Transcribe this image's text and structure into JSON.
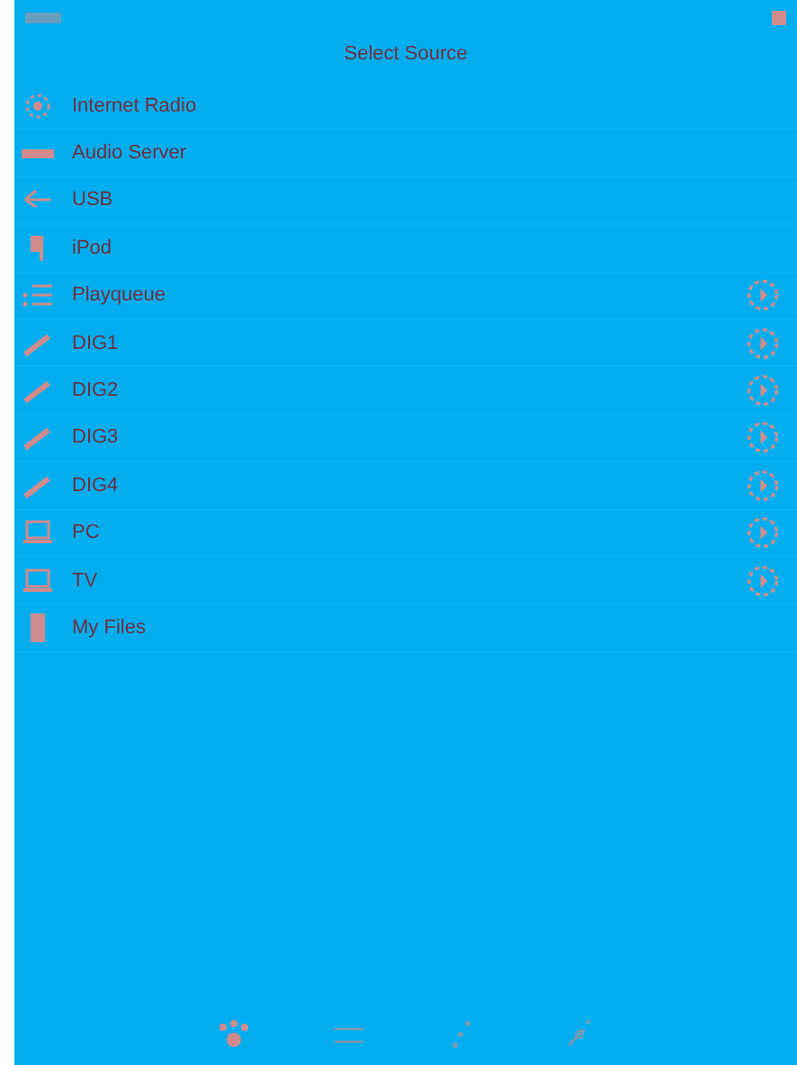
{
  "title": "Select Source",
  "sources": [
    {
      "label": "Internet Radio",
      "kind": "radio",
      "info": false
    },
    {
      "label": "Audio Server",
      "kind": "server",
      "info": false
    },
    {
      "label": "USB",
      "kind": "usb",
      "info": false
    },
    {
      "label": "iPod",
      "kind": "ipod",
      "info": false
    },
    {
      "label": "Playqueue",
      "kind": "queue",
      "info": true
    },
    {
      "label": "DIG1",
      "kind": "plug",
      "info": true
    },
    {
      "label": "DIG2",
      "kind": "plug",
      "info": true
    },
    {
      "label": "DIG3",
      "kind": "plug",
      "info": true
    },
    {
      "label": "DIG4",
      "kind": "plug",
      "info": true
    },
    {
      "label": "PC",
      "kind": "laptop",
      "info": true
    },
    {
      "label": "TV",
      "kind": "laptop",
      "info": true
    },
    {
      "label": "My Files",
      "kind": "file",
      "info": false
    }
  ],
  "tabs": [
    {
      "kind": "paw",
      "selected": true
    },
    {
      "kind": "lines",
      "selected": false
    },
    {
      "kind": "dots",
      "selected": false
    },
    {
      "kind": "sparkle",
      "selected": false
    }
  ]
}
